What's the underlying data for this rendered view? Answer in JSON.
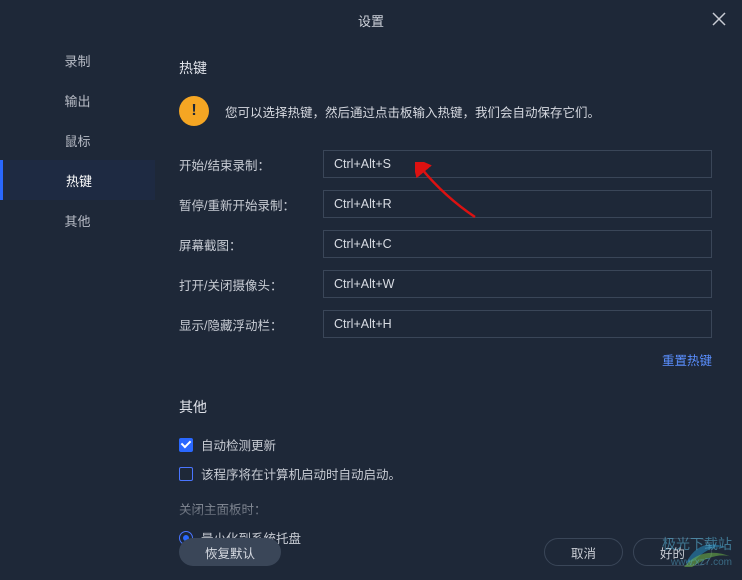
{
  "title": "设置",
  "sidebar": {
    "items": [
      {
        "label": "录制"
      },
      {
        "label": "输出"
      },
      {
        "label": "鼠标"
      },
      {
        "label": "热键"
      },
      {
        "label": "其他"
      }
    ],
    "active_index": 3
  },
  "hotkeys": {
    "section_title": "热键",
    "info_text": "您可以选择热键，然后通过点击板输入热键，我们会自动保存它们。",
    "rows": [
      {
        "label": "开始/结束录制：",
        "value": "Ctrl+Alt+S"
      },
      {
        "label": "暂停/重新开始录制：",
        "value": "Ctrl+Alt+R"
      },
      {
        "label": "屏幕截图：",
        "value": "Ctrl+Alt+C"
      },
      {
        "label": "打开/关闭摄像头：",
        "value": "Ctrl+Alt+W"
      },
      {
        "label": "显示/隐藏浮动栏：",
        "value": "Ctrl+Alt+H"
      }
    ],
    "reset_label": "重置热键"
  },
  "other": {
    "section_title": "其他",
    "auto_update_label": "自动检测更新",
    "auto_update_checked": true,
    "autostart_label": "该程序将在计算机启动时自动启动。",
    "autostart_checked": false,
    "close_panel_label": "关闭主面板时：",
    "minimize_tray_label": "最小化到系统托盘",
    "minimize_tray_checked": true
  },
  "footer": {
    "restore_default": "恢复默认",
    "cancel": "取消",
    "ok": "好的"
  },
  "watermark": {
    "text": "极光下载站",
    "url": "www.xz7.com"
  }
}
